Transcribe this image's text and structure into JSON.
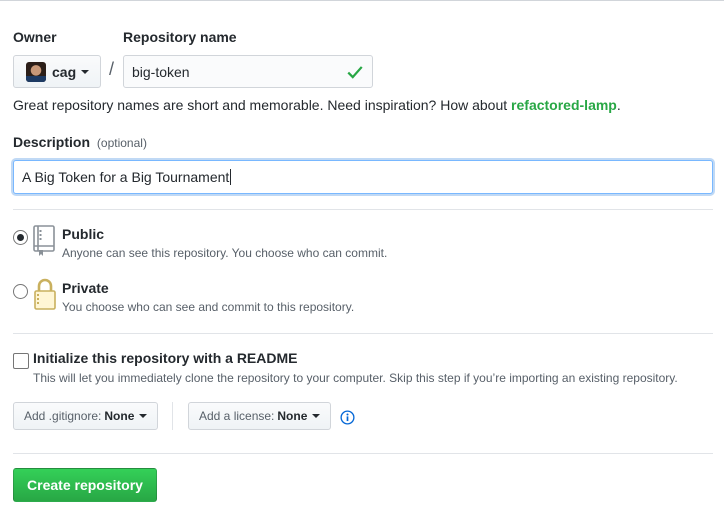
{
  "owner": {
    "label": "Owner",
    "name": "cag"
  },
  "repository": {
    "label": "Repository name",
    "value": "big-token",
    "separator": "/"
  },
  "hint": {
    "text": "Great repository names are short and memorable. Need inspiration? How about ",
    "suggestion": "refactored-lamp",
    "end": "."
  },
  "description": {
    "label": "Description",
    "optional": "(optional)",
    "value": "A Big Token for a Big Tournament"
  },
  "visibility": {
    "public": {
      "title": "Public",
      "note": "Anyone can see this repository. You choose who can commit.",
      "selected": true
    },
    "private": {
      "title": "Private",
      "note": "You choose who can see and commit to this repository.",
      "selected": false
    }
  },
  "readme": {
    "title": "Initialize this repository with a README",
    "note": "This will let you immediately clone the repository to your computer. Skip this step if you’re importing an existing repository.",
    "checked": false
  },
  "gitignore": {
    "label": "Add .gitignore:",
    "value": "None"
  },
  "license": {
    "label": "Add a license:",
    "value": "None"
  },
  "create_button": "Create repository",
  "colors": {
    "accent_green": "#28a745",
    "focus_blue": "#79b8ff",
    "info_blue": "#0366d6"
  }
}
